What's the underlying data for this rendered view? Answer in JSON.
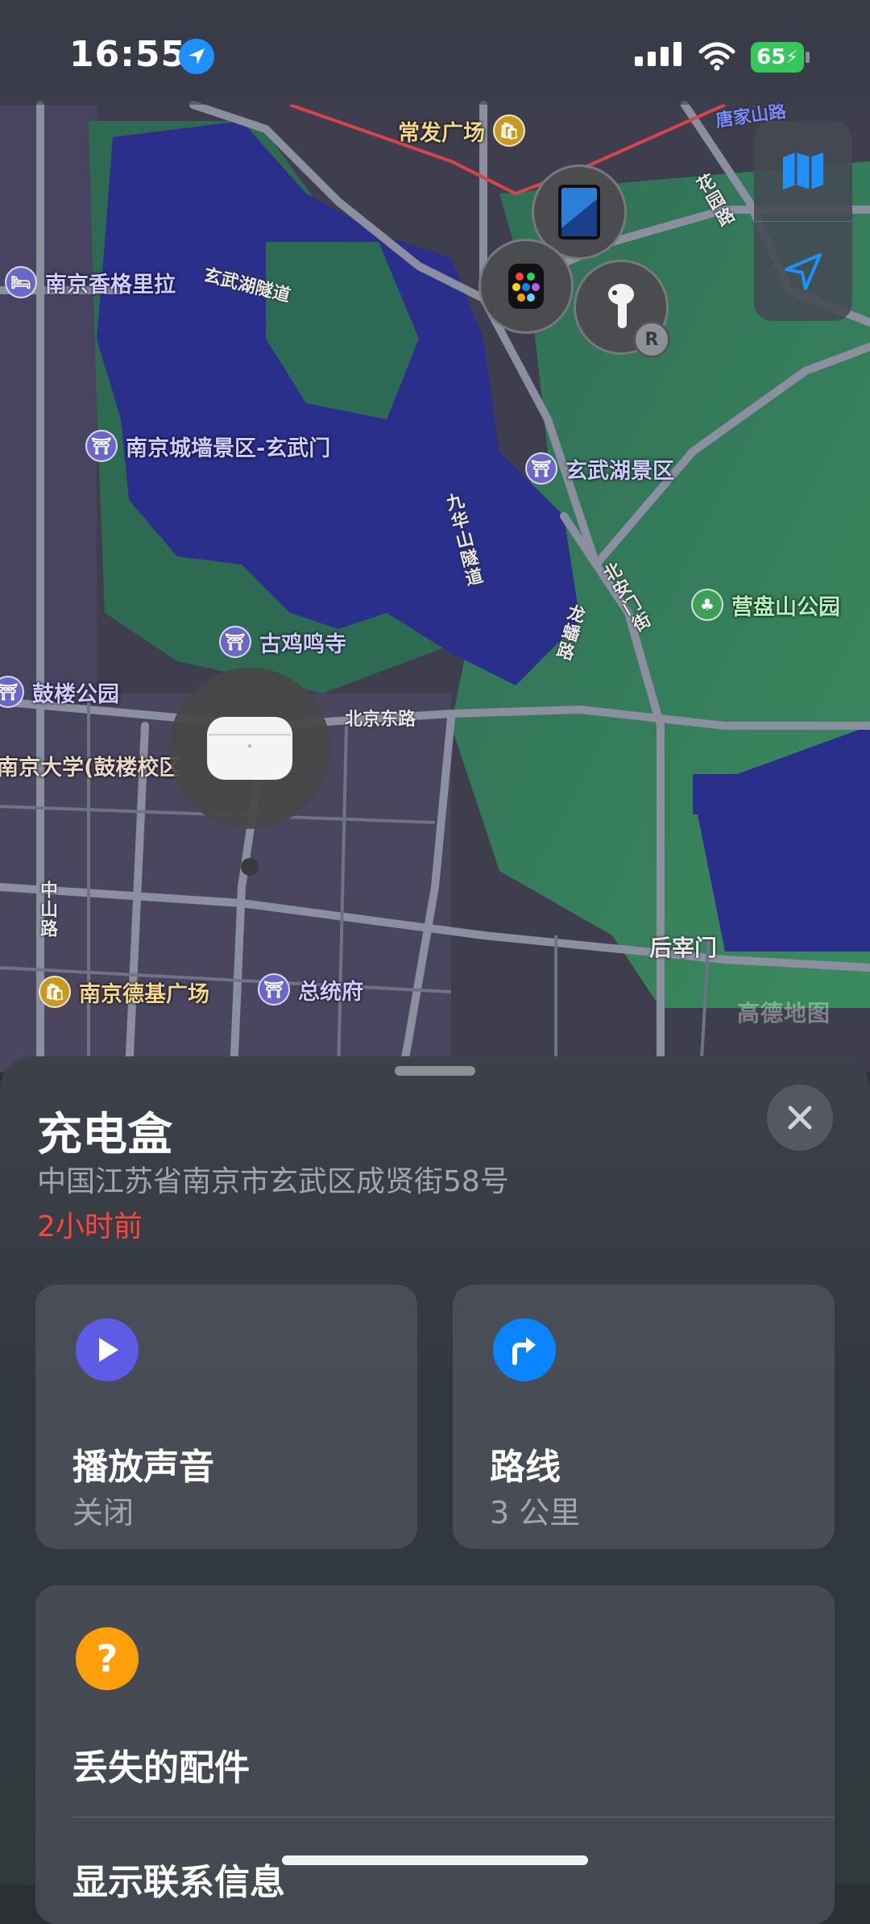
{
  "status_bar": {
    "time": "16:55",
    "battery": "65"
  },
  "map": {
    "pois": [
      {
        "name": "常发广场",
        "kind": "shopping"
      },
      {
        "name": "南京香格里拉",
        "kind": "hotel"
      },
      {
        "name": "南京城墙景区-玄武门",
        "kind": "landmark"
      },
      {
        "name": "玄武湖景区",
        "kind": "landmark"
      },
      {
        "name": "营盘山公园",
        "kind": "park"
      },
      {
        "name": "古鸡鸣寺",
        "kind": "temple"
      },
      {
        "name": "鼓楼公园",
        "kind": "landmark"
      },
      {
        "name": "南京大学(鼓楼校区",
        "kind": "school"
      },
      {
        "name": "南京德基广场",
        "kind": "shopping"
      },
      {
        "name": "总统府",
        "kind": "landmark"
      }
    ],
    "roads": [
      "玄武湖隧道",
      "九华山隧道",
      "北京东路",
      "龙蟠路",
      "北安门街",
      "花园路",
      "中山路",
      "后宰门",
      "唐家山路"
    ],
    "watermark": "高德地图"
  },
  "sheet": {
    "title": "充电盒",
    "address": "中国江苏省南京市玄武区成贤街58号",
    "time_ago": "2小时前",
    "play_sound": {
      "title": "播放声音",
      "subtitle": "关闭"
    },
    "directions": {
      "title": "路线",
      "subtitle": "3 公里"
    },
    "lost_accessory": {
      "title": "丢失的配件",
      "contact": "显示联系信息"
    }
  },
  "colors": {
    "accent_blue": "#0a84ff",
    "play_purple": "#5e5ce6",
    "warning_orange": "#ff9f0a",
    "time_red": "#ff453a"
  }
}
